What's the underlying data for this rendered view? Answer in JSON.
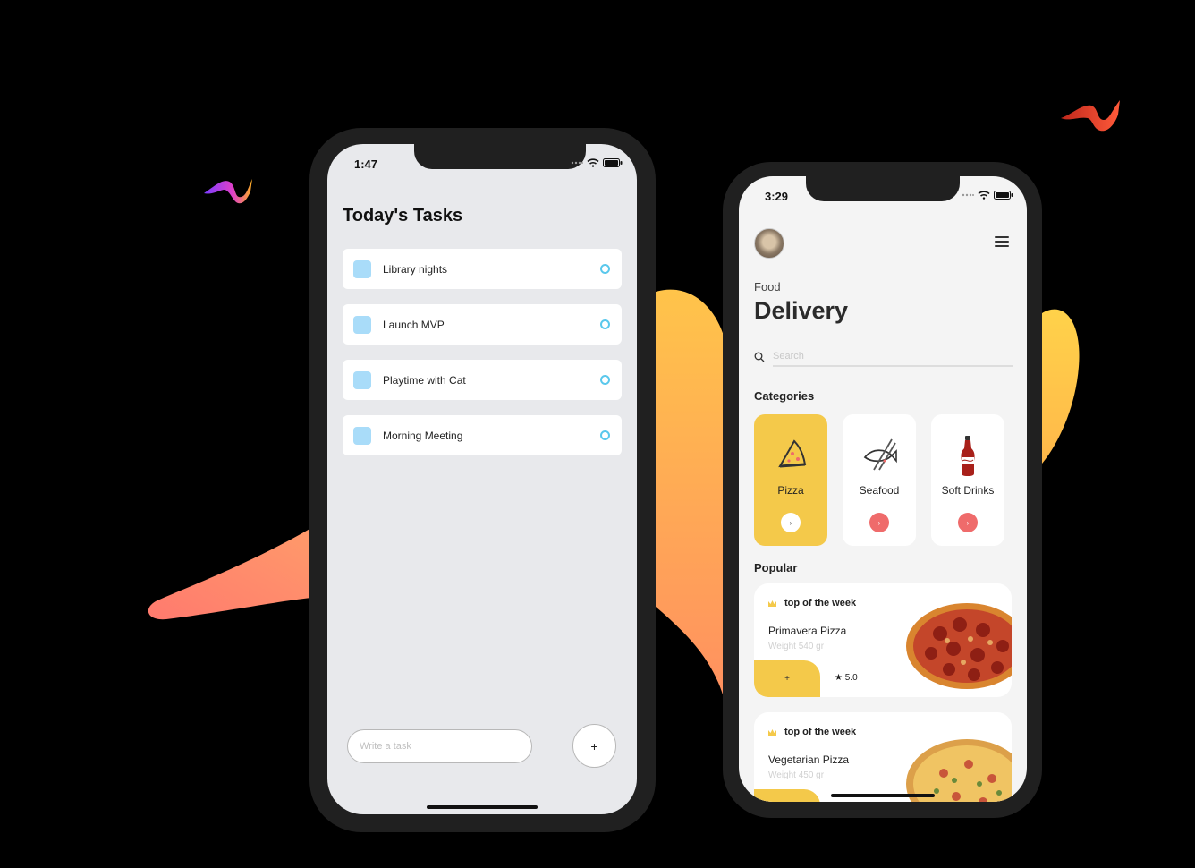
{
  "colors": {
    "background": "#000000",
    "accent_yellow": "#f4c94a",
    "accent_red": "#ef6b6b",
    "task_checkbox": "#a9dcf9",
    "task_circle": "#5ac8ec"
  },
  "tasks_app": {
    "status_time": "1:47",
    "title": "Today's Tasks",
    "tasks": [
      {
        "label": "Library nights"
      },
      {
        "label": "Launch MVP"
      },
      {
        "label": "Playtime with Cat"
      },
      {
        "label": "Morning Meeting"
      }
    ],
    "input_placeholder": "Write a task",
    "add_label": "+"
  },
  "food_app": {
    "status_time": "3:29",
    "kicker": "Food",
    "title": "Delivery",
    "search_placeholder": "Search",
    "categories_title": "Categories",
    "categories": [
      {
        "label": "Pizza",
        "icon": "pizza-slice-icon",
        "arrow": "›",
        "active": true
      },
      {
        "label": "Seafood",
        "icon": "seafood-icon",
        "arrow": "›",
        "active": false
      },
      {
        "label": "Soft Drinks",
        "icon": "soda-bottle-icon",
        "arrow": "›",
        "active": false
      }
    ],
    "popular_title": "Popular",
    "popular": [
      {
        "badge": "top of the week",
        "name": "Primavera Pizza",
        "weight": "Weight 540 gr",
        "add_label": "+",
        "rating": "★ 5.0"
      },
      {
        "badge": "top of the week",
        "name": "Vegetarian Pizza",
        "weight": "Weight 450 gr",
        "add_label": "+",
        "rating": ""
      }
    ]
  }
}
